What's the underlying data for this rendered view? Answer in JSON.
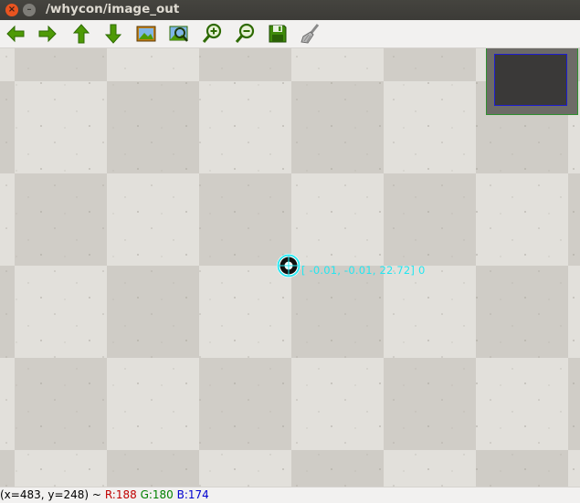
{
  "window": {
    "title": "/whycon/image_out"
  },
  "toolbar": {
    "buttons": [
      {
        "name": "pan-left-button",
        "icon": "arrow-left-icon"
      },
      {
        "name": "pan-right-button",
        "icon": "arrow-right-icon"
      },
      {
        "name": "pan-up-button",
        "icon": "arrow-up-icon"
      },
      {
        "name": "pan-down-button",
        "icon": "arrow-down-icon"
      },
      {
        "name": "zoom-reset-button",
        "icon": "picture-icon"
      },
      {
        "name": "zoom-fit-button",
        "icon": "zoom-image-icon"
      },
      {
        "name": "zoom-in-button",
        "icon": "zoom-in-icon"
      },
      {
        "name": "zoom-out-button",
        "icon": "zoom-out-icon"
      },
      {
        "name": "save-button",
        "icon": "floppy-disk-icon"
      },
      {
        "name": "properties-button",
        "icon": "brush-icon"
      }
    ]
  },
  "overlay": {
    "marker_label": "[ -0.01,  -0.01,  22.72] 0"
  },
  "status": {
    "coords": "(x=483, y=248) ~",
    "r": "R:188",
    "g": "G:180",
    "b": "B:174"
  },
  "colors": {
    "status_r": "#c00000",
    "status_g": "#008000",
    "status_b": "#0000d0",
    "overlay_label": "#23e6f0"
  }
}
